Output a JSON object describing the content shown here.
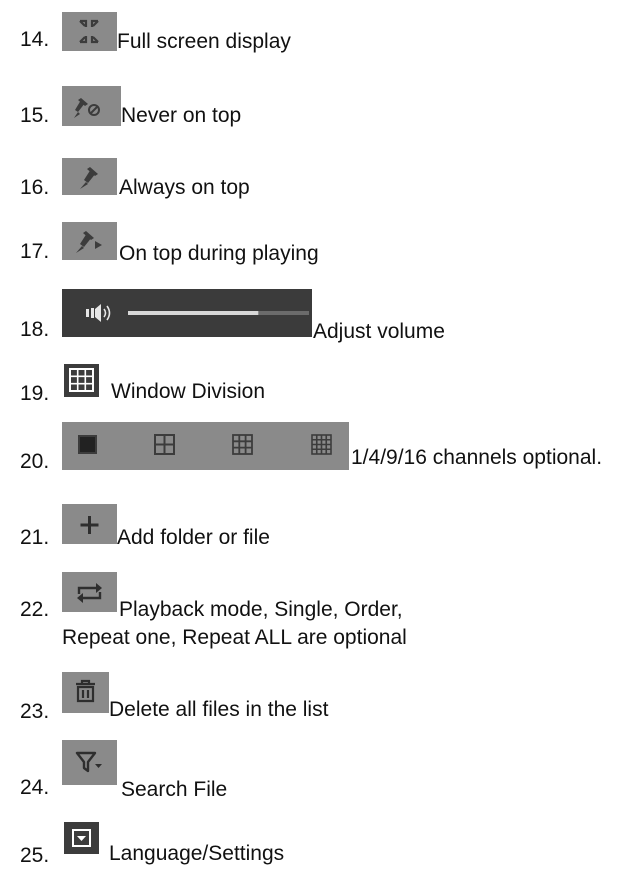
{
  "colors": {
    "icon_grey": "#8a8a8a",
    "icon_dark": "#3c3c3c",
    "volume_bg": "#3b3b3b",
    "volume_track": "#6b6b6b",
    "volume_fill": "#d8d8d8",
    "text": "#111111"
  },
  "items": [
    {
      "number": "14.",
      "icon": "fullscreen-icon",
      "label": "Full screen display"
    },
    {
      "number": "15.",
      "icon": "never-on-top-pin-icon",
      "label": "Never on top"
    },
    {
      "number": "16.",
      "icon": "always-on-top-pin-icon",
      "label": "Always on top"
    },
    {
      "number": "17.",
      "icon": "on-top-playing-pin-icon",
      "label": "On top during playing"
    },
    {
      "number": "18.",
      "icon": "volume-slider-icon",
      "label": "Adjust volume",
      "volume_level": 0.72
    },
    {
      "number": "19.",
      "icon": "window-division-icon",
      "label": "Window Division"
    },
    {
      "number": "20.",
      "icon": "channel-layout-icons",
      "label": "1/4/9/16 channels optional."
    },
    {
      "number": "21.",
      "icon": "add-icon",
      "label": "Add folder or file"
    },
    {
      "number": "22.",
      "icon": "repeat-icon",
      "label": "Playback mode, Single, Order,",
      "label_line2": "Repeat one, Repeat ALL are optional"
    },
    {
      "number": "23.",
      "icon": "trash-icon",
      "label": "Delete all files in the list"
    },
    {
      "number": "24.",
      "icon": "filter-icon",
      "label": "Search File"
    },
    {
      "number": "25.",
      "icon": "settings-dropdown-icon",
      "label": "Language/Settings"
    }
  ]
}
